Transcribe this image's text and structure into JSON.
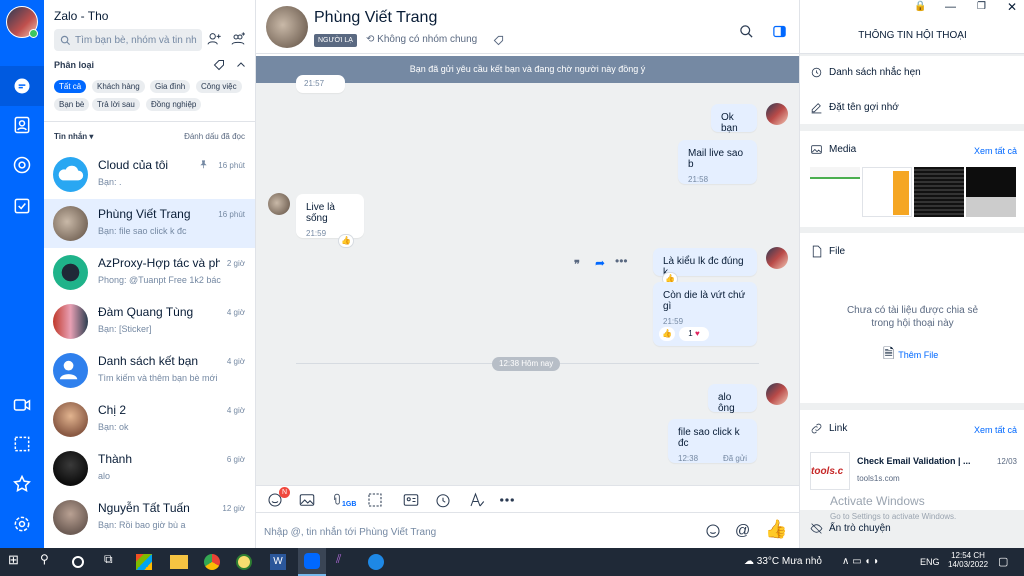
{
  "app": {
    "title": "Zalo - Tho",
    "search_placeholder": "Tìm bạn bè, nhóm và tin nhắn"
  },
  "filter": {
    "title": "Phân loại",
    "chips": [
      "Tất cả",
      "Khách hàng",
      "Gia đình",
      "Công việc",
      "Bạn bè",
      "Trả lời sau",
      "Đồng nghiệp"
    ]
  },
  "list_header": {
    "label": "Tin nhắn",
    "mark_read": "Đánh dấu đã đọc"
  },
  "conversations": [
    {
      "name": "Cloud của tôi",
      "preview": "Bạn: .",
      "time": "16 phút"
    },
    {
      "name": "Phùng Viết Trang",
      "preview": "Bạn: file sao click k đc",
      "time": "16 phút"
    },
    {
      "name": "AzProxy-Hợp tác và ph...",
      "preview": "Phong: @Tuanpt Free 1k2 bác",
      "time": "2 giờ"
    },
    {
      "name": "Đàm Quang Tùng",
      "preview": "Bạn: [Sticker]",
      "time": "4 giờ"
    },
    {
      "name": "Danh sách kết bạn",
      "preview": "Tìm kiếm và thêm bạn bè mới",
      "time": "4 giờ"
    },
    {
      "name": "Chị 2",
      "preview": "Bạn: ok",
      "time": "4 giờ"
    },
    {
      "name": "Thành",
      "preview": "alo",
      "time": "6 giờ"
    },
    {
      "name": "Nguyễn Tất Tuấn",
      "preview": "Bạn: Rồi bao giờ bù a",
      "time": "12 giờ"
    }
  ],
  "chat": {
    "name": "Phùng Viết Trang",
    "stranger_tag": "NGƯỜI LẠ",
    "no_group": "Không có nhóm chung",
    "banner": "Bạn đã gửi yêu cầu kết bạn và đang chờ người này đồng ý",
    "top_time": "21:57",
    "m1": {
      "text": "Ok bạn"
    },
    "m2": {
      "text": "Mail live sao b",
      "time": "21:58"
    },
    "m3": {
      "text": "Live là sống",
      "time": "21:59"
    },
    "m4": {
      "text": "Là kiểu lk đc đúng k"
    },
    "m5": {
      "text": "Còn die là vứt chứ gì",
      "time": "21:59",
      "reaction": "1"
    },
    "divider": "12:38 Hôm nay",
    "m6": {
      "text": "alo ông"
    },
    "m7": {
      "text": "file sao click k đc",
      "time": "12:38",
      "status": "Đã gửi"
    },
    "composer_placeholder": "Nhập @, tin nhắn tới Phùng Viết Trang",
    "file_badge": "1GB",
    "sticker_badge": "N"
  },
  "info": {
    "title": "Thông tin hội thoại",
    "reminders": "Danh sách nhắc hẹn",
    "nickname": "Đặt tên gợi nhớ",
    "media": "Media",
    "see_all": "Xem tất cả",
    "file": "File",
    "file_empty": "Chưa có tài liệu được chia sẻ trong hội thoại này",
    "add_file": "Thêm File",
    "link": "Link",
    "link_title": "Check Email Validation | ...",
    "link_date": "12/03",
    "link_domain": "tools1s.com",
    "link_thumb": "tools.c",
    "activate": "Activate Windows",
    "activate_sub": "Go to Settings to activate Windows.",
    "hide_chat": "Ẩn trò chuyện"
  },
  "taskbar": {
    "weather": "33°C Mưa nhỏ",
    "lang": "ENG",
    "time": "12:54 CH",
    "date": "14/03/2022"
  }
}
